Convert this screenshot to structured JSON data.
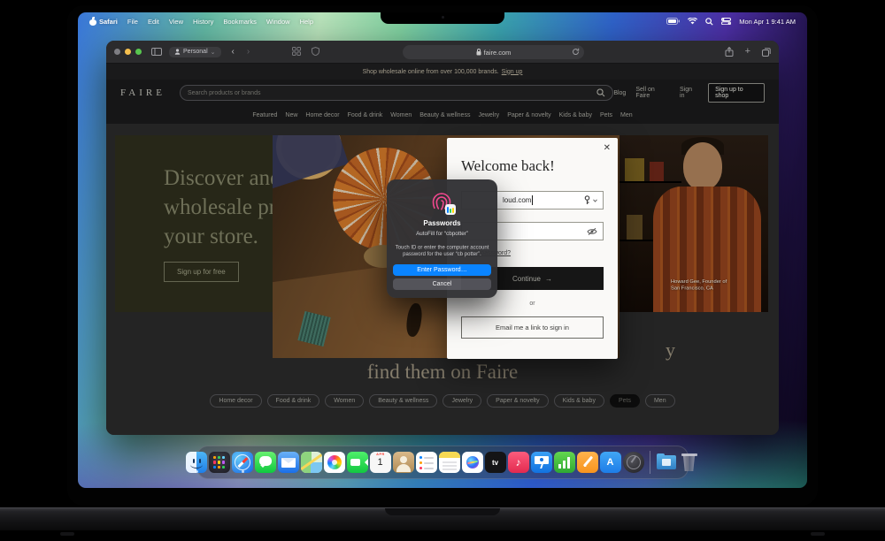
{
  "menubar": {
    "items": [
      "Safari",
      "File",
      "Edit",
      "View",
      "History",
      "Bookmarks",
      "Window",
      "Help"
    ],
    "clock": "Mon Apr 1  9:41 AM"
  },
  "browser": {
    "tab_group": "Personal",
    "url": "faire.com",
    "back": "‹",
    "forward": "›",
    "tab_group_caret": "⌄",
    "plus": "+"
  },
  "site": {
    "banner_text": "Shop wholesale online from over 100,000 brands.",
    "banner_link": "Sign up",
    "logo": "FAIRE",
    "search_placeholder": "Search products or brands",
    "header_links": [
      "Blog",
      "Sell on Faire",
      "Sign in"
    ],
    "header_cta": "Sign up to shop",
    "nav": [
      "Featured",
      "New",
      "Home decor",
      "Food & drink",
      "Women",
      "Beauty & wellness",
      "Jewelry",
      "Paper & novelty",
      "Kids & baby",
      "Pets",
      "Men"
    ],
    "hero": {
      "line1": "Discover and",
      "line2": "wholesale products for",
      "line3": "your store.",
      "cta": "Sign up for free",
      "caption_line1": "Howard Gee, Founder of",
      "caption_line2": "San Francisco, CA"
    },
    "bottom_heading": "find them on Faire",
    "heading_fragment": "y",
    "pills": [
      "Home decor",
      "Food & drink",
      "Women",
      "Beauty & wellness",
      "Jewelry",
      "Paper & novelty",
      "Kids & baby",
      "Pets",
      "Men"
    ],
    "selected_pill": "Pets"
  },
  "modal": {
    "title": "Welcome back!",
    "close": "✕",
    "email_visible_value": "loud.com",
    "forgot": "Forgot password?",
    "continue_label": "Continue",
    "continue_arrow": "→",
    "or": "or",
    "magic_link": "Email me a link to sign in"
  },
  "touchid": {
    "app": "Passwords",
    "autofill": "AutoFill for “cbpotter”",
    "body_line1": "Touch ID or enter the computer account",
    "body_line2": "password for the user “cb potter”.",
    "primary": "Enter Password…",
    "cancel": "Cancel"
  },
  "dock": {
    "apps": [
      "Finder",
      "Launchpad",
      "Safari",
      "Messages",
      "Mail",
      "Maps",
      "Photos",
      "FaceTime",
      "Calendar",
      "Contacts",
      "Reminders",
      "Notes",
      "Siri",
      "TV",
      "Music",
      "Keynote",
      "Numbers",
      "Pages",
      "App Store",
      "GarageBand",
      "Downloads",
      "Trash"
    ],
    "calendar_month": "APR",
    "calendar_day": "1",
    "tv_label": "tv",
    "music_glyph": "♪",
    "appstore_glyph": "A"
  },
  "colors": {
    "accent_blue": "#0a84ff",
    "fingerprint_pink": "#f2488f",
    "traffic_yellow": "#f5bf4e",
    "traffic_green": "#58c64f"
  }
}
